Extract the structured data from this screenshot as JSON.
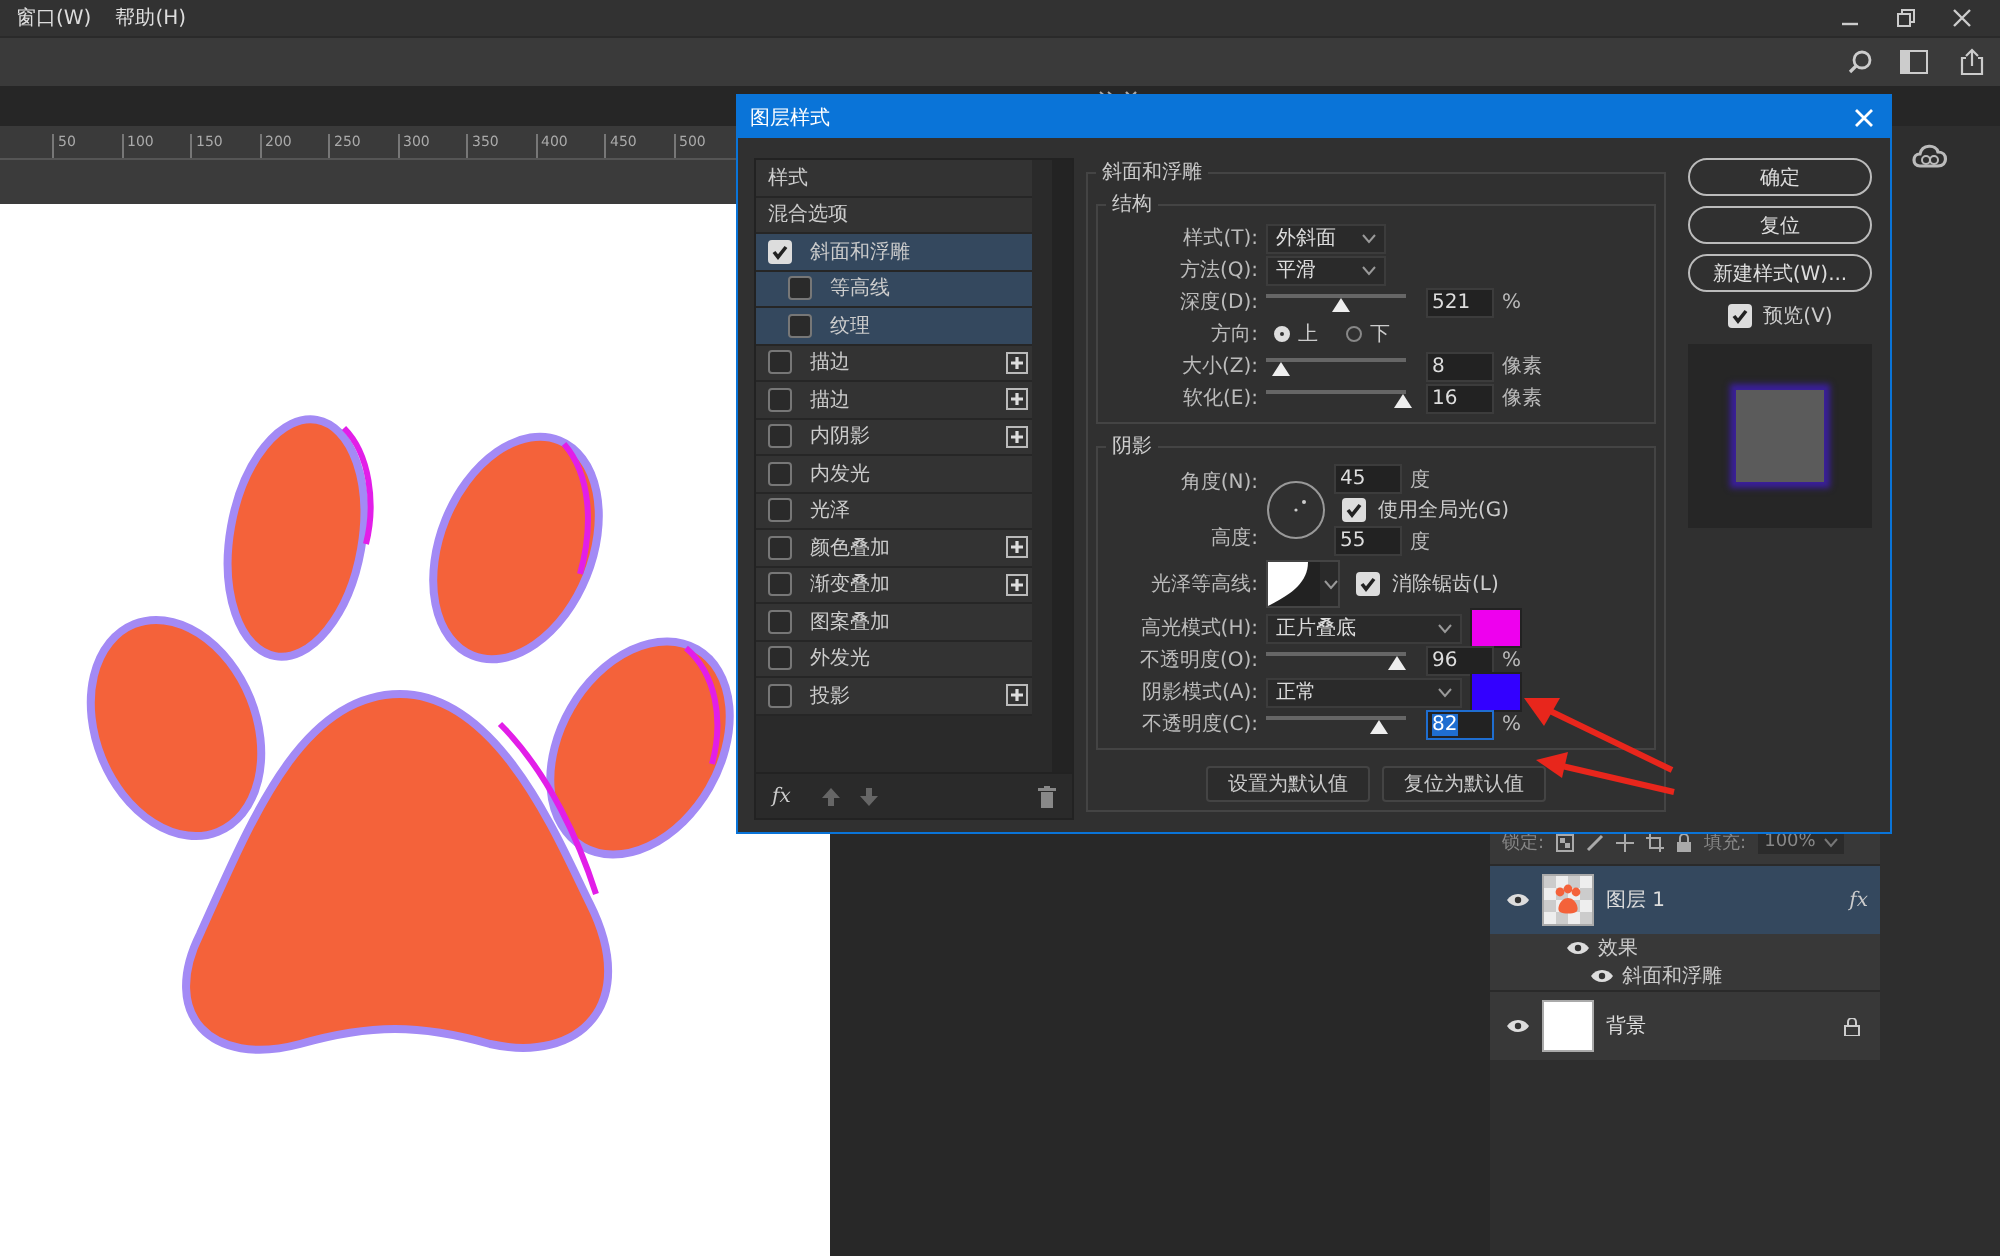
{
  "menu": [
    {
      "label": "窗口(W)"
    },
    {
      "label": "帮助(H)"
    }
  ],
  "ruler": {
    "ticks": [
      "50",
      "100",
      "150",
      "200",
      "250",
      "300",
      "350",
      "400",
      "450",
      "500"
    ]
  },
  "dialog": {
    "title": "图层样式",
    "styles_list": [
      {
        "label": "样式",
        "kind": "heading",
        "selected": false
      },
      {
        "label": "混合选项",
        "kind": "heading",
        "selected": false
      },
      {
        "label": "斜面和浮雕",
        "kind": "effect",
        "checked": true,
        "selected": true,
        "add": false,
        "children": [
          {
            "label": "等高线",
            "checked": false,
            "selected": true
          },
          {
            "label": "纹理",
            "checked": false,
            "selected": true
          }
        ]
      },
      {
        "label": "描边",
        "kind": "effect",
        "checked": false,
        "selected": false,
        "add": true
      },
      {
        "label": "描边",
        "kind": "effect",
        "checked": false,
        "selected": false,
        "add": true
      },
      {
        "label": "内阴影",
        "kind": "effect",
        "checked": false,
        "selected": false,
        "add": true
      },
      {
        "label": "内发光",
        "kind": "effect",
        "checked": false,
        "selected": false,
        "add": false
      },
      {
        "label": "光泽",
        "kind": "effect",
        "checked": false,
        "selected": false,
        "add": false
      },
      {
        "label": "颜色叠加",
        "kind": "effect",
        "checked": false,
        "selected": false,
        "add": true
      },
      {
        "label": "渐变叠加",
        "kind": "effect",
        "checked": false,
        "selected": false,
        "add": true
      },
      {
        "label": "图案叠加",
        "kind": "effect",
        "checked": false,
        "selected": false,
        "add": false
      },
      {
        "label": "外发光",
        "kind": "effect",
        "checked": false,
        "selected": false,
        "add": false
      },
      {
        "label": "投影",
        "kind": "effect",
        "checked": false,
        "selected": false,
        "add": true
      }
    ],
    "list_footer": {
      "fx": "fx"
    },
    "bevel": {
      "title": "斜面和浮雕",
      "structure": {
        "title": "结构",
        "style": {
          "label": "样式(T):",
          "value": "外斜面"
        },
        "technique": {
          "label": "方法(Q):",
          "value": "平滑"
        },
        "depth": {
          "label": "深度(D):",
          "level": 0.52,
          "value": "521",
          "unit": "%"
        },
        "direction": {
          "label": "方向:",
          "options": [
            {
              "label": "上",
              "selected": true
            },
            {
              "label": "下",
              "selected": false
            }
          ]
        },
        "size": {
          "label": "大小(Z):",
          "level": 0.05,
          "value": "8",
          "unit": "像素"
        },
        "soften": {
          "label": "软化(E):",
          "level": 1,
          "value": "16",
          "unit": "像素"
        }
      },
      "shading": {
        "title": "阴影",
        "angle": {
          "label": "角度(N):",
          "value": "45",
          "unit": "度"
        },
        "global_light": {
          "label": "使用全局光(G)",
          "checked": true
        },
        "altitude": {
          "label": "高度:",
          "value": "55",
          "unit": "度"
        },
        "gloss_contour": {
          "label": "光泽等高线:"
        },
        "anti_aliased": {
          "label": "消除锯齿(L)",
          "checked": true
        },
        "highlight_mode": {
          "label": "高光模式(H):",
          "value": "正片叠底",
          "color": "#ee00ee"
        },
        "highlight_opacity": {
          "label": "不透明度(O):",
          "level": 0.96,
          "value": "96",
          "unit": "%",
          "selected": false
        },
        "shadow_mode": {
          "label": "阴影模式(A):",
          "value": "正常",
          "color": "#3300ff"
        },
        "shadow_opacity": {
          "label": "不透明度(C):",
          "level": 0.82,
          "value": "82",
          "unit": "%",
          "selected": true
        }
      },
      "buttons": [
        {
          "label": "设置为默认值"
        },
        {
          "label": "复位为默认值"
        }
      ]
    },
    "actions": [
      {
        "label": "确定"
      },
      {
        "label": "复位"
      },
      {
        "label": "新建样式(W)..."
      }
    ],
    "preview": {
      "label": "预览(V)",
      "checked": true
    }
  },
  "layers_panel": {
    "lock_label": "锁定:",
    "fill_label": "填充:",
    "fill_value": "100%",
    "layers": [
      {
        "name": "图层 1",
        "kind": "paw",
        "selected": true,
        "fx": "fx",
        "effects_label": "效果",
        "effects": [
          "斜面和浮雕"
        ]
      },
      {
        "name": "背景",
        "kind": "white",
        "selected": false,
        "locked": true
      }
    ]
  }
}
